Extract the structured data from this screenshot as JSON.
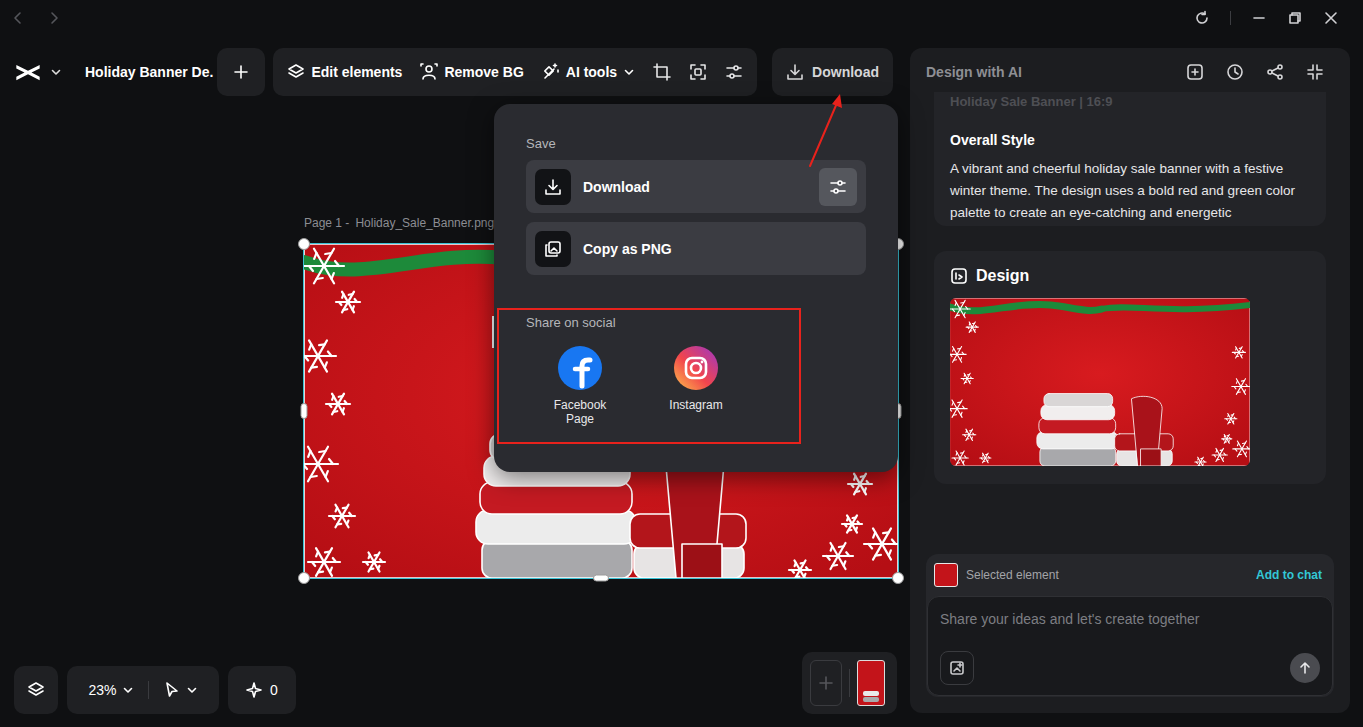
{
  "project": {
    "title": "Holiday Banner De."
  },
  "toolbar": {
    "tools": [
      {
        "label": "Edit elements",
        "kind": "layers"
      },
      {
        "label": "Remove BG",
        "kind": "remove-bg"
      },
      {
        "label": "AI tools",
        "kind": "menu"
      }
    ],
    "download": "Download"
  },
  "canvas": {
    "page_label": "Page 1 -",
    "file_name": "Holiday_Sale_Banner.png",
    "selected": true
  },
  "download_menu": {
    "save_heading": "Save",
    "actions": [
      {
        "label": "Download",
        "kind": "settings"
      },
      {
        "label": "Copy as PNG",
        "kind": "plain"
      }
    ],
    "social_heading": "Share on social",
    "social": [
      {
        "label": "Facebook Page",
        "kind": "facebook"
      },
      {
        "label": "Instagram",
        "kind": "instagram"
      }
    ]
  },
  "bottom_bar": {
    "zoom": "23%",
    "ai_count": "0"
  },
  "ai_panel": {
    "title": "Design with AI",
    "spec_title": "Holiday Sale Banner | 16:9",
    "style_heading": "Overall Style",
    "style_text": "A vibrant and cheerful holiday sale banner with a festive winter theme. The design uses a bold red and green color palette to create an eye-catching and energetic",
    "design_heading": "Design",
    "chat": {
      "selected_label": "Selected element",
      "add_label": "Add to chat",
      "placeholder": "Share your ideas and let's create together"
    }
  }
}
